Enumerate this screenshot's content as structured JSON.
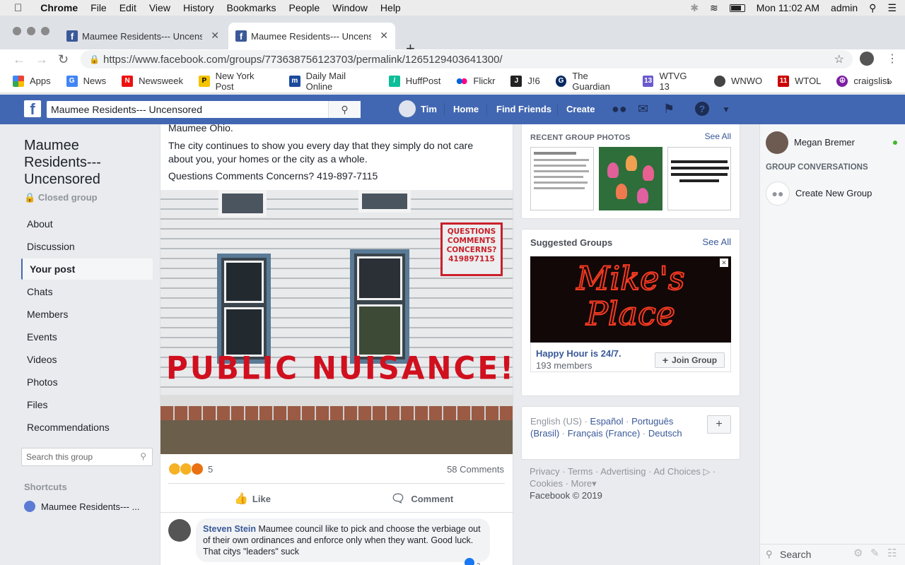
{
  "macmenu": {
    "items": [
      "Chrome",
      "File",
      "Edit",
      "View",
      "History",
      "Bookmarks",
      "People",
      "Window",
      "Help"
    ],
    "clock": "Mon 11:02 AM",
    "user": "admin"
  },
  "browser": {
    "tabs": [
      {
        "title": "Maumee Residents--- Uncenso"
      },
      {
        "title": "Maumee Residents--- Uncenso"
      }
    ],
    "url": "https://www.facebook.com/groups/773638756123703/permalink/1265129403641300/",
    "bookmarks": [
      "Apps",
      "News",
      "Newsweek",
      "New York Post",
      "Daily Mail Online",
      "HuffPost",
      "Flickr",
      "J!6",
      "The Guardian",
      "WTVG 13",
      "WNWO",
      "WTOL",
      "craigslist"
    ]
  },
  "fb": {
    "search_value": "Maumee Residents--- Uncensored",
    "nav": {
      "user": "Tim",
      "home": "Home",
      "find_friends": "Find Friends",
      "create": "Create"
    }
  },
  "group": {
    "title_line1": "Maumee",
    "title_line2": "Residents---",
    "title_line3": "Uncensored",
    "privacy": "Closed group",
    "nav": [
      "About",
      "Discussion",
      "Your post",
      "Chats",
      "Members",
      "Events",
      "Videos",
      "Photos",
      "Files",
      "Recommendations"
    ],
    "search_placeholder": "Search this group",
    "shortcuts_label": "Shortcuts",
    "shortcut_item": "Maumee Residents--- ..."
  },
  "post": {
    "text_top": "Maumee Ohio.",
    "text_p1": "The city continues to show you every day that they simply do not care about you, your homes or the city as a whole.",
    "text_p2": "Questions Comments Concerns? 419-897-7115",
    "image_sign": [
      "QUESTIONS",
      "COMMENTS",
      "CONCERNS?",
      "419897115"
    ],
    "image_banner": "PUBLIC NUISANCE!",
    "reaction_count": "5",
    "comment_count": "58 Comments",
    "like_label": "Like",
    "comment_label": "Comment",
    "comment": {
      "author": "Steven Stein",
      "text": "Maumee council like to pick and choose the verbiage out of their own ordinances and enforce only when they want. Good luck. That citys \"leaders\" suck",
      "likes": "2"
    }
  },
  "photos_card": {
    "title": "RECENT GROUP PHOTOS",
    "see_all": "See All"
  },
  "suggested": {
    "title": "Suggested Groups",
    "see_all": "See All",
    "banner_line1": "Mike's",
    "banner_line2": "Place",
    "group_name": "Happy Hour is 24/7.",
    "members": "193 members",
    "join_label": "Join Group"
  },
  "languages": {
    "current": "English (US)",
    "list": [
      "Español",
      "Português (Brasil)",
      "Français (France)",
      "Deutsch"
    ]
  },
  "footer": {
    "links": [
      "Privacy",
      "Terms",
      "Advertising",
      "Ad Choices",
      "Cookies",
      "More"
    ],
    "copyright": "Facebook © 2019"
  },
  "chat": {
    "contact": "Megan Bremer",
    "section": "GROUP CONVERSATIONS",
    "create": "Create New Group",
    "search_placeholder": "Search"
  }
}
